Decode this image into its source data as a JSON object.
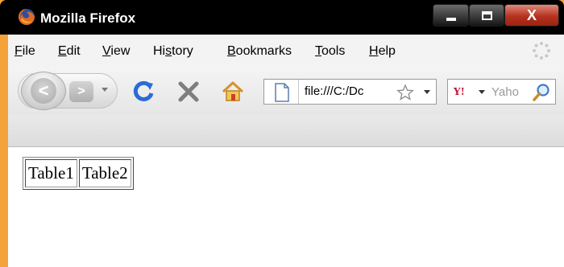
{
  "window": {
    "title": "Mozilla Firefox",
    "controls": {
      "minimize": "",
      "maximize": "",
      "close": "X"
    }
  },
  "menubar": {
    "items": [
      {
        "label": "File",
        "mnemonic": "F"
      },
      {
        "label": "Edit",
        "mnemonic": "E"
      },
      {
        "label": "View",
        "mnemonic": "V"
      },
      {
        "label": "History",
        "mnemonic": "s"
      },
      {
        "label": "Bookmarks",
        "mnemonic": "B"
      },
      {
        "label": "Tools",
        "mnemonic": "T"
      },
      {
        "label": "Help",
        "mnemonic": "H"
      }
    ]
  },
  "navbar": {
    "back_glyph": "<",
    "forward_glyph": ">",
    "url": "file:///C:/Dc",
    "search_engine": "Y!",
    "search_placeholder": "Yaho",
    "icons": [
      "back-icon",
      "forward-icon",
      "history-dropdown-icon",
      "reload-icon",
      "stop-icon",
      "home-icon",
      "page-icon",
      "bookmark-star-icon",
      "url-dropdown-icon",
      "yahoo-icon",
      "search-icon"
    ]
  },
  "page": {
    "table": {
      "cells": [
        "Table1",
        "Table2"
      ]
    }
  },
  "colors": {
    "frame": "#f3a33a",
    "titlebar": "#000000",
    "close_button": "#b5321f",
    "reload": "#2a6bd6",
    "stop": "#7e7e7e",
    "home": "#e4a629"
  }
}
